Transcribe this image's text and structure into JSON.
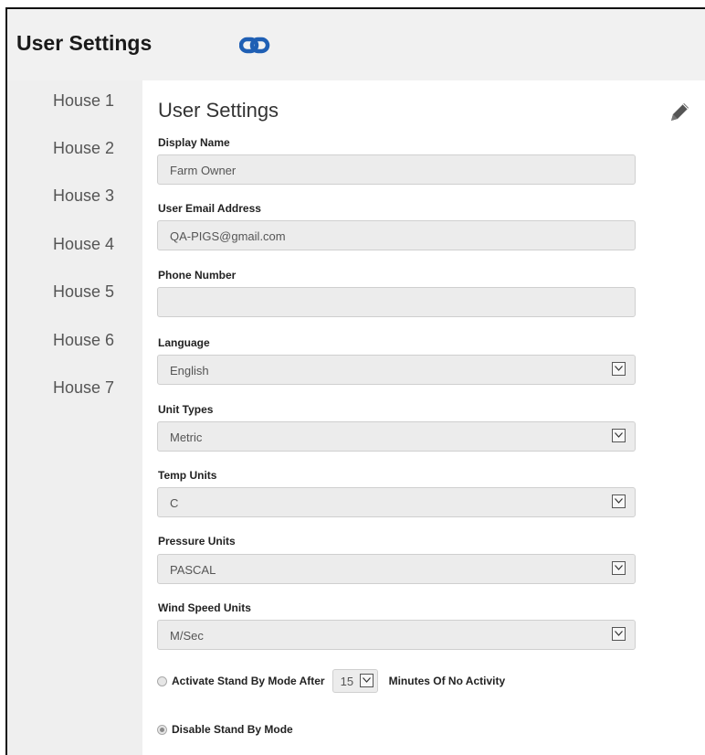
{
  "header": {
    "title": "User Settings",
    "link_icon": "link-icon"
  },
  "sidebar": {
    "items": [
      {
        "label": "House 1"
      },
      {
        "label": "House 2"
      },
      {
        "label": "House 3"
      },
      {
        "label": "House 4"
      },
      {
        "label": "House 5"
      },
      {
        "label": "House 6"
      },
      {
        "label": "House 7"
      }
    ]
  },
  "main": {
    "title": "User Settings",
    "edit_icon": "pencil-icon",
    "display_name": {
      "label": "Display Name",
      "value": "Farm Owner"
    },
    "email": {
      "label": "User Email Address",
      "value": "QA-PIGS@gmail.com"
    },
    "phone": {
      "label": "Phone Number",
      "value": ""
    },
    "language": {
      "label": "Language",
      "value": "English"
    },
    "unit_types": {
      "label": "Unit Types",
      "value": "Metric"
    },
    "temp_units": {
      "label": "Temp Units",
      "value": "C"
    },
    "pressure_units": {
      "label": "Pressure Units",
      "value": "PASCAL"
    },
    "wind_speed_units": {
      "label": "Wind Speed Units",
      "value": "M/Sec"
    },
    "standby": {
      "activate_label": "Activate Stand By Mode After",
      "minutes_value": "15",
      "minutes_suffix": "Minutes Of No Activity",
      "disable_label": "Disable Stand By Mode",
      "selected": "disable"
    }
  },
  "colors": {
    "link_icon": "#1f5fb4",
    "header_bg": "#f1f1f1",
    "sidebar_bg": "#efefef",
    "field_bg": "#ececec"
  }
}
